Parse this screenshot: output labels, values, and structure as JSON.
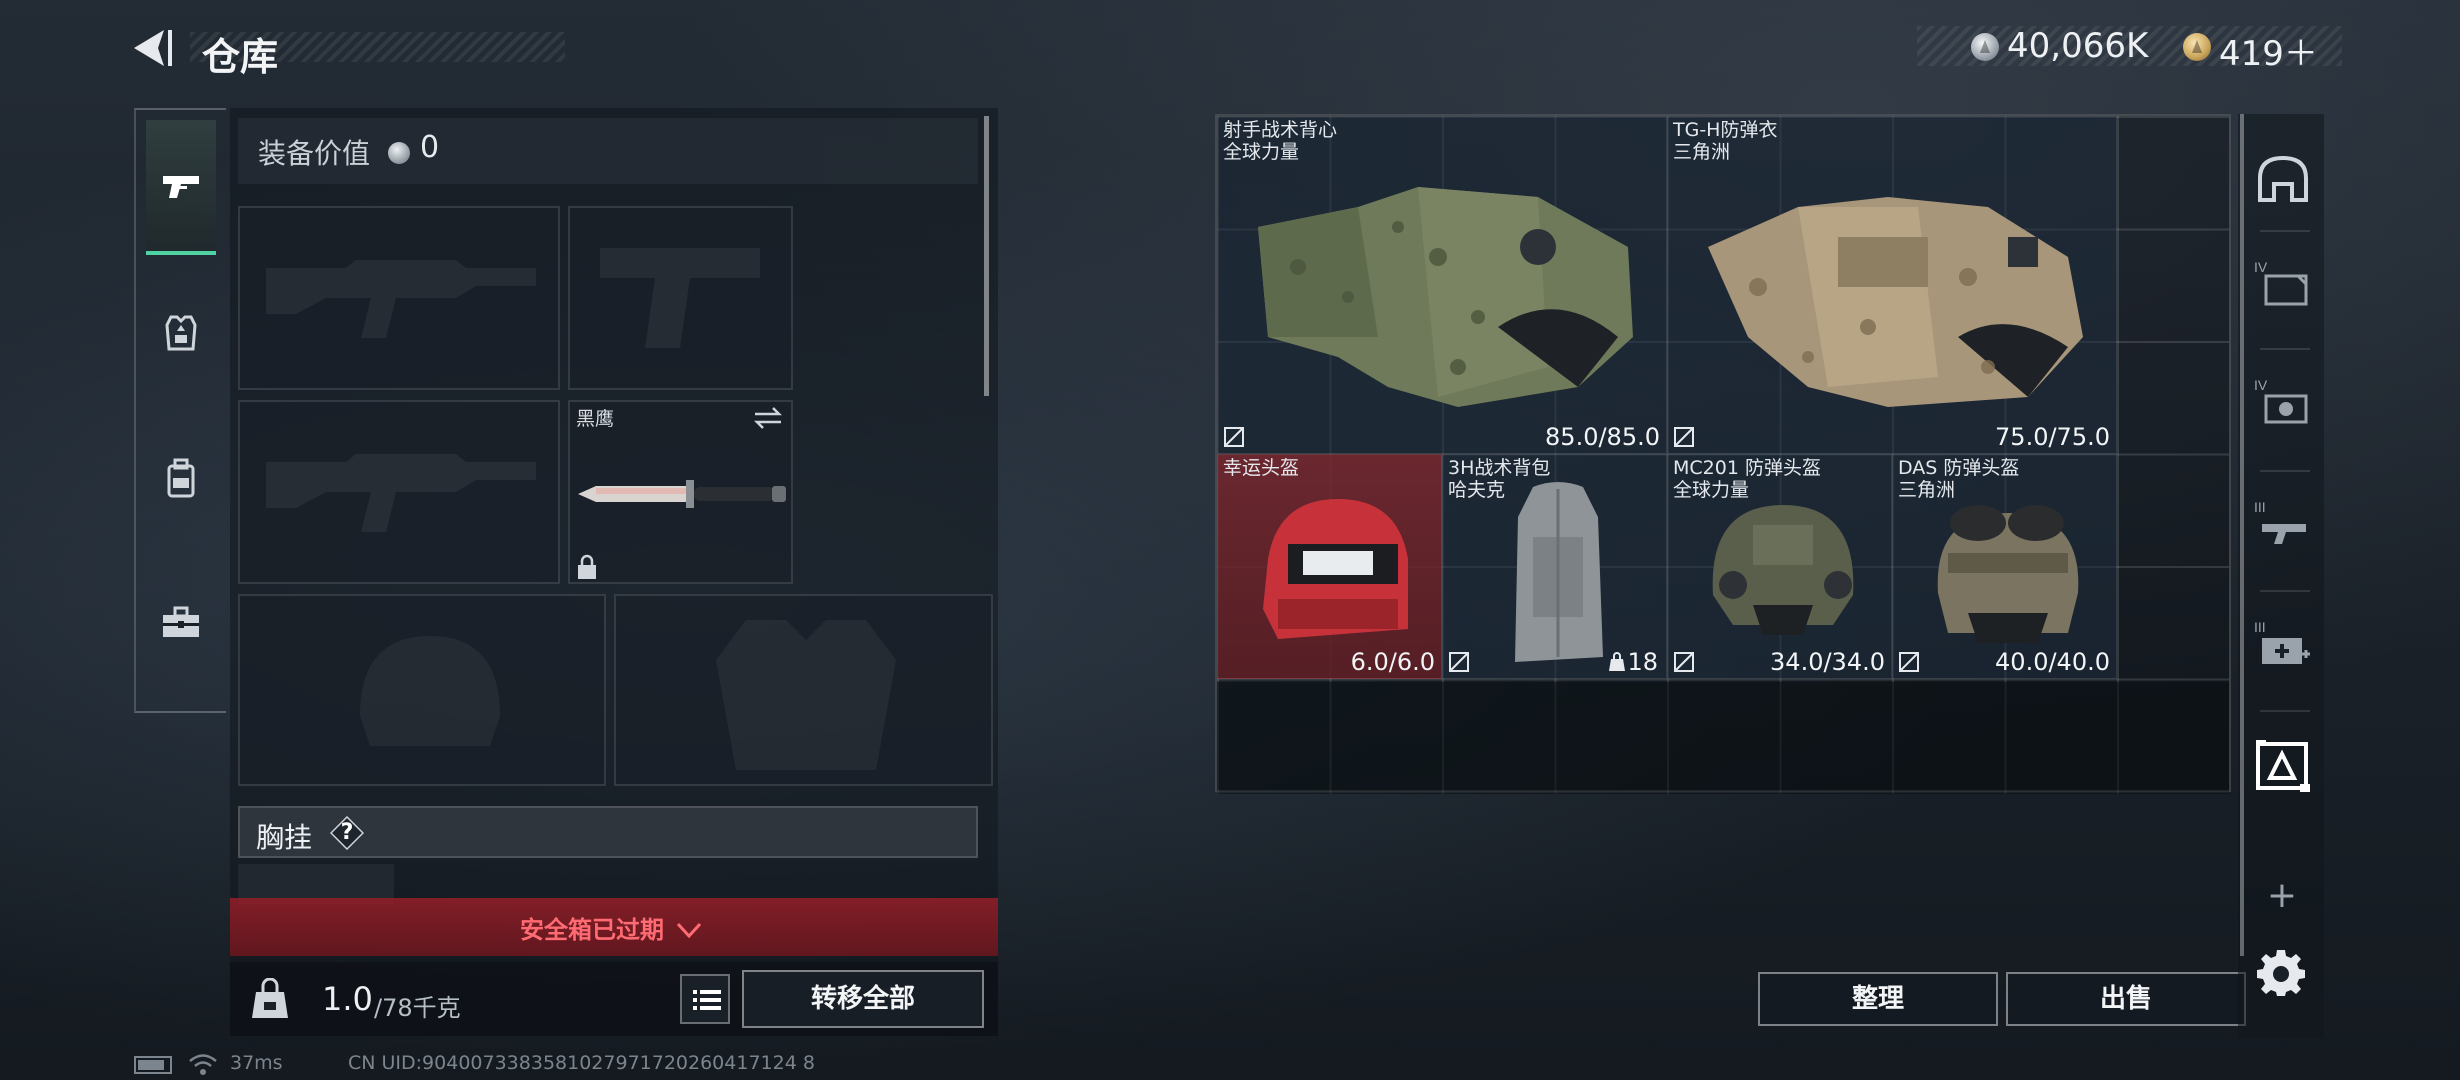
{
  "header": {
    "title": "仓库",
    "silver_amount": "40,066K",
    "gold_amount": "419＋"
  },
  "left_rail": {
    "tabs": [
      {
        "icon": "pistol-icon",
        "active": true
      },
      {
        "icon": "armor-icon",
        "active": false
      },
      {
        "icon": "backpack-icon",
        "active": false
      },
      {
        "icon": "toolbox-icon",
        "active": false
      }
    ]
  },
  "equipment": {
    "value_label": "装备价值",
    "value": "0",
    "melee_name": "黑鹰",
    "chest_label": "胸挂",
    "help_glyph": "?",
    "safe_box_text": "安全箱已过期",
    "weight_current": "1.0",
    "weight_capacity": "/78千克",
    "transfer_all": "转移全部"
  },
  "stash": {
    "items": [
      {
        "name": "射手战术背心",
        "sub": "全球力量",
        "durability": "85.0/85.0"
      },
      {
        "name": "TG-H防弹衣",
        "sub": "三角洲",
        "durability": "75.0/75.0"
      },
      {
        "name": "幸运头盔",
        "sub": "",
        "durability": "6.0/6.0"
      },
      {
        "name": "3H战术背包",
        "sub": "哈夫克",
        "count": "18"
      },
      {
        "name": "MC201 防弹头盔",
        "sub": "全球力量",
        "durability": "34.0/34.0"
      },
      {
        "name": "DAS 防弹头盔",
        "sub": "三角洲",
        "durability": "40.0/40.0"
      }
    ],
    "sort_label": "整理",
    "sell_label": "出售"
  },
  "right_rail": {
    "items": [
      "helmet-slot-icon",
      "armor-iv-icon",
      "vest-iv-icon",
      "weapon-iii-icon",
      "medkit-iii-icon",
      "delta-box-icon"
    ],
    "plus": "+"
  },
  "status": {
    "ping": "37ms",
    "uid": "CN UID:9040073383581027971720260417124 8"
  },
  "colors": {
    "accent_green": "#4fd1a1",
    "alert_red": "#ff6b72",
    "red_item_bg": "#782830"
  }
}
